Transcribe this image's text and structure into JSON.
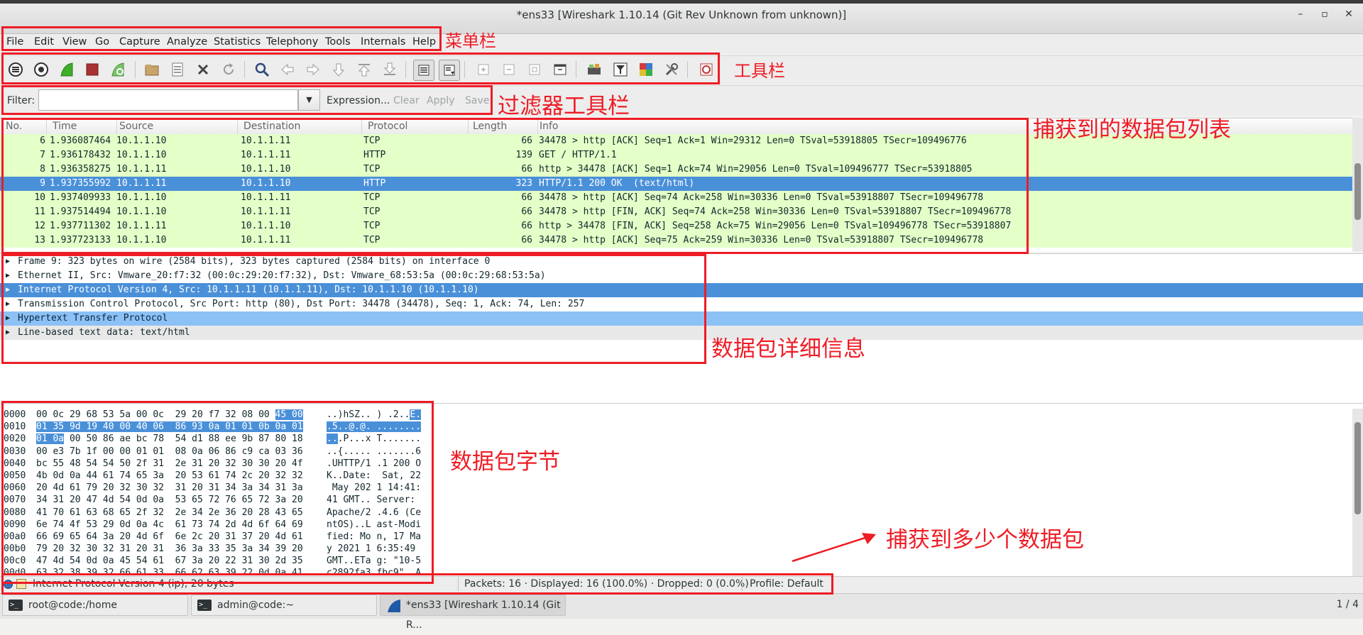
{
  "window": {
    "title": "*ens33   [Wireshark 1.10.14  (Git Rev Unknown from unknown)]",
    "minimize_glyph": "–",
    "maximize_glyph": "▫",
    "close_glyph": "✕"
  },
  "menu": [
    "File",
    "Edit",
    "View",
    "Go",
    "Capture",
    "Analyze",
    "Statistics",
    "Telephony",
    "Tools",
    "Internals",
    "Help"
  ],
  "toolbar_icons": [
    "interface-list-icon",
    "capture-options-icon",
    "start-capture-icon",
    "stop-capture-icon",
    "restart-capture-icon",
    "open-file-icon",
    "save-file-icon",
    "close-file-icon",
    "reload-icon",
    "find-packet-icon",
    "go-back-icon",
    "go-forward-icon",
    "go-to-packet-icon",
    "go-first-icon",
    "go-last-icon",
    "colorize-icon",
    "auto-scroll-icon",
    "zoom-in-icon",
    "zoom-out-icon",
    "normal-size-icon",
    "resize-columns-icon",
    "capture-filters-icon",
    "display-filters-icon",
    "coloring-rules-icon",
    "preferences-icon",
    "help-icon"
  ],
  "filter": {
    "label": "Filter:",
    "value": "",
    "expression": "Expression...",
    "clear": "Clear",
    "apply": "Apply",
    "save": "Save"
  },
  "packet_list": {
    "columns": [
      "No.",
      "Time",
      "Source",
      "Destination",
      "Protocol",
      "Length",
      "Info"
    ],
    "rows": [
      {
        "no": "6",
        "time": "1.936087464",
        "src": "10.1.1.10",
        "dst": "10.1.1.11",
        "proto": "TCP",
        "len": "66",
        "info": "34478 > http [ACK] Seq=1 Ack=1 Win=29312 Len=0 TSval=53918805 TSecr=109496776",
        "selected": false
      },
      {
        "no": "7",
        "time": "1.936178432",
        "src": "10.1.1.10",
        "dst": "10.1.1.11",
        "proto": "HTTP",
        "len": "139",
        "info": "GET / HTTP/1.1",
        "selected": false
      },
      {
        "no": "8",
        "time": "1.936358275",
        "src": "10.1.1.11",
        "dst": "10.1.1.10",
        "proto": "TCP",
        "len": "66",
        "info": "http > 34478 [ACK] Seq=1 Ack=74 Win=29056 Len=0 TSval=109496777 TSecr=53918805",
        "selected": false
      },
      {
        "no": "9",
        "time": "1.937355992",
        "src": "10.1.1.11",
        "dst": "10.1.1.10",
        "proto": "HTTP",
        "len": "323",
        "info": "HTTP/1.1 200 OK  (text/html)",
        "selected": true
      },
      {
        "no": "10",
        "time": "1.937409933",
        "src": "10.1.1.10",
        "dst": "10.1.1.11",
        "proto": "TCP",
        "len": "66",
        "info": "34478 > http [ACK] Seq=74 Ack=258 Win=30336 Len=0 TSval=53918807 TSecr=109496778",
        "selected": false
      },
      {
        "no": "11",
        "time": "1.937514494",
        "src": "10.1.1.10",
        "dst": "10.1.1.11",
        "proto": "TCP",
        "len": "66",
        "info": "34478 > http [FIN, ACK] Seq=74 Ack=258 Win=30336 Len=0 TSval=53918807 TSecr=109496778",
        "selected": false
      },
      {
        "no": "12",
        "time": "1.937711302",
        "src": "10.1.1.11",
        "dst": "10.1.1.10",
        "proto": "TCP",
        "len": "66",
        "info": "http > 34478 [FIN, ACK] Seq=258 Ack=75 Win=29056 Len=0 TSval=109496778 TSecr=53918807",
        "selected": false
      },
      {
        "no": "13",
        "time": "1.937723133",
        "src": "10.1.1.10",
        "dst": "10.1.1.11",
        "proto": "TCP",
        "len": "66",
        "info": "34478 > http [ACK] Seq=75 Ack=259 Win=30336 Len=0 TSval=53918807 TSecr=109496778",
        "selected": false
      }
    ]
  },
  "details": [
    {
      "text": "Frame 9: 323 bytes on wire (2584 bits), 323 bytes captured (2584 bits) on interface 0",
      "style": "normal"
    },
    {
      "text": "Ethernet II, Src: Vmware_20:f7:32 (00:0c:29:20:f7:32), Dst: Vmware_68:53:5a (00:0c:29:68:53:5a)",
      "style": "normal"
    },
    {
      "text": "Internet Protocol Version 4, Src: 10.1.1.11 (10.1.1.11), Dst: 10.1.1.10 (10.1.1.10)",
      "style": "ip"
    },
    {
      "text": "Transmission Control Protocol, Src Port: http (80), Dst Port: 34478 (34478), Seq: 1, Ack: 74, Len: 257",
      "style": "normal"
    },
    {
      "text": "Hypertext Transfer Protocol",
      "style": "http"
    },
    {
      "text": "Line-based text data: text/html",
      "style": "line"
    }
  ],
  "hex_dump": [
    {
      "offset": "0000",
      "hex": [
        "00 0c 29 68 53 5a 00 0c  29 20 f7 32 08 00 ",
        "45 00",
        ""
      ],
      "ascii": [
        "..)hSZ.. ) .2..",
        "E.",
        ""
      ]
    },
    {
      "offset": "0010",
      "hex": [
        "",
        "01 35 9d 19 40 00 40 06  86 93 0a 01 01 0b 0a 01",
        ""
      ],
      "ascii": [
        "",
        ".5..@.@. ........",
        ""
      ]
    },
    {
      "offset": "0020",
      "hex": [
        "",
        "01 0a",
        " 00 50 86 ae bc 78  54 d1 88 ee 9b 87 80 18"
      ],
      "ascii": [
        "",
        "..",
        ".P...x T......."
      ]
    },
    {
      "offset": "0030",
      "hex": [
        "00 e3 7b 1f 00 00 01 01  08 0a 06 86 c9 ca 03 36",
        "",
        ""
      ],
      "ascii": [
        "..{..... .......6",
        "",
        ""
      ]
    },
    {
      "offset": "0040",
      "hex": [
        "bc 55 48 54 54 50 2f 31  2e 31 20 32 30 30 20 4f",
        "",
        ""
      ],
      "ascii": [
        ".UHTTP/1 .1 200 O",
        "",
        ""
      ]
    },
    {
      "offset": "0050",
      "hex": [
        "4b 0d 0a 44 61 74 65 3a  20 53 61 74 2c 20 32 32",
        "",
        ""
      ],
      "ascii": [
        "K..Date:  Sat, 22",
        "",
        ""
      ]
    },
    {
      "offset": "0060",
      "hex": [
        "20 4d 61 79 20 32 30 32  31 20 31 34 3a 34 31 3a",
        "",
        ""
      ],
      "ascii": [
        " May 202 1 14:41:",
        "",
        ""
      ]
    },
    {
      "offset": "0070",
      "hex": [
        "34 31 20 47 4d 54 0d 0a  53 65 72 76 65 72 3a 20",
        "",
        ""
      ],
      "ascii": [
        "41 GMT.. Server: ",
        "",
        ""
      ]
    },
    {
      "offset": "0080",
      "hex": [
        "41 70 61 63 68 65 2f 32  2e 34 2e 36 20 28 43 65",
        "",
        ""
      ],
      "ascii": [
        "Apache/2 .4.6 (Ce",
        "",
        ""
      ]
    },
    {
      "offset": "0090",
      "hex": [
        "6e 74 4f 53 29 0d 0a 4c  61 73 74 2d 4d 6f 64 69",
        "",
        ""
      ],
      "ascii": [
        "ntOS)..L ast-Modi",
        "",
        ""
      ]
    },
    {
      "offset": "00a0",
      "hex": [
        "66 69 65 64 3a 20 4d 6f  6e 2c 20 31 37 20 4d 61",
        "",
        ""
      ],
      "ascii": [
        "fied: Mo n, 17 Ma",
        "",
        ""
      ]
    },
    {
      "offset": "00b0",
      "hex": [
        "79 20 32 30 32 31 20 31  36 3a 33 35 3a 34 39 20",
        "",
        ""
      ],
      "ascii": [
        "y 2021 1 6:35:49 ",
        "",
        ""
      ]
    },
    {
      "offset": "00c0",
      "hex": [
        "47 4d 54 0d 0a 45 54 61  67 3a 20 22 31 30 2d 35",
        "",
        ""
      ],
      "ascii": [
        "GMT..ETa g: \"10-5",
        "",
        ""
      ]
    },
    {
      "offset": "00d0",
      "hex": [
        "63 32 38 39 32 66 61 33  66 62 63 39 22 0d 0a 41",
        "",
        ""
      ],
      "ascii": [
        "c2892fa3 fbc9\"..A",
        "",
        ""
      ]
    }
  ],
  "status": {
    "field": "Internet Protocol Version 4 (ip), 20 bytes",
    "packets": "Packets: 16 · Displayed: 16 (100.0%)  · Dropped: 0 (0.0%)",
    "profile": "Profile: Default"
  },
  "taskbar": {
    "items": [
      "root@code:/home",
      "admin@code:~",
      "*ens33   [Wireshark 1.10.14  (Git R..."
    ],
    "workspace": "1 / 4"
  },
  "annotations": {
    "menubar": "菜单栏",
    "toolbar": "工具栏",
    "filterbar": "过滤器工具栏",
    "packet_list": "捕获到的数据包列表",
    "details": "数据包详细信息",
    "bytes": "数据包字节",
    "count": "捕获到多少个数据包"
  },
  "colors": {
    "annotation_red": "#ee1c25",
    "row_green": "#e4ffc7",
    "selection_blue": "#4a90d9",
    "http_light_blue": "#8cc1f5"
  }
}
